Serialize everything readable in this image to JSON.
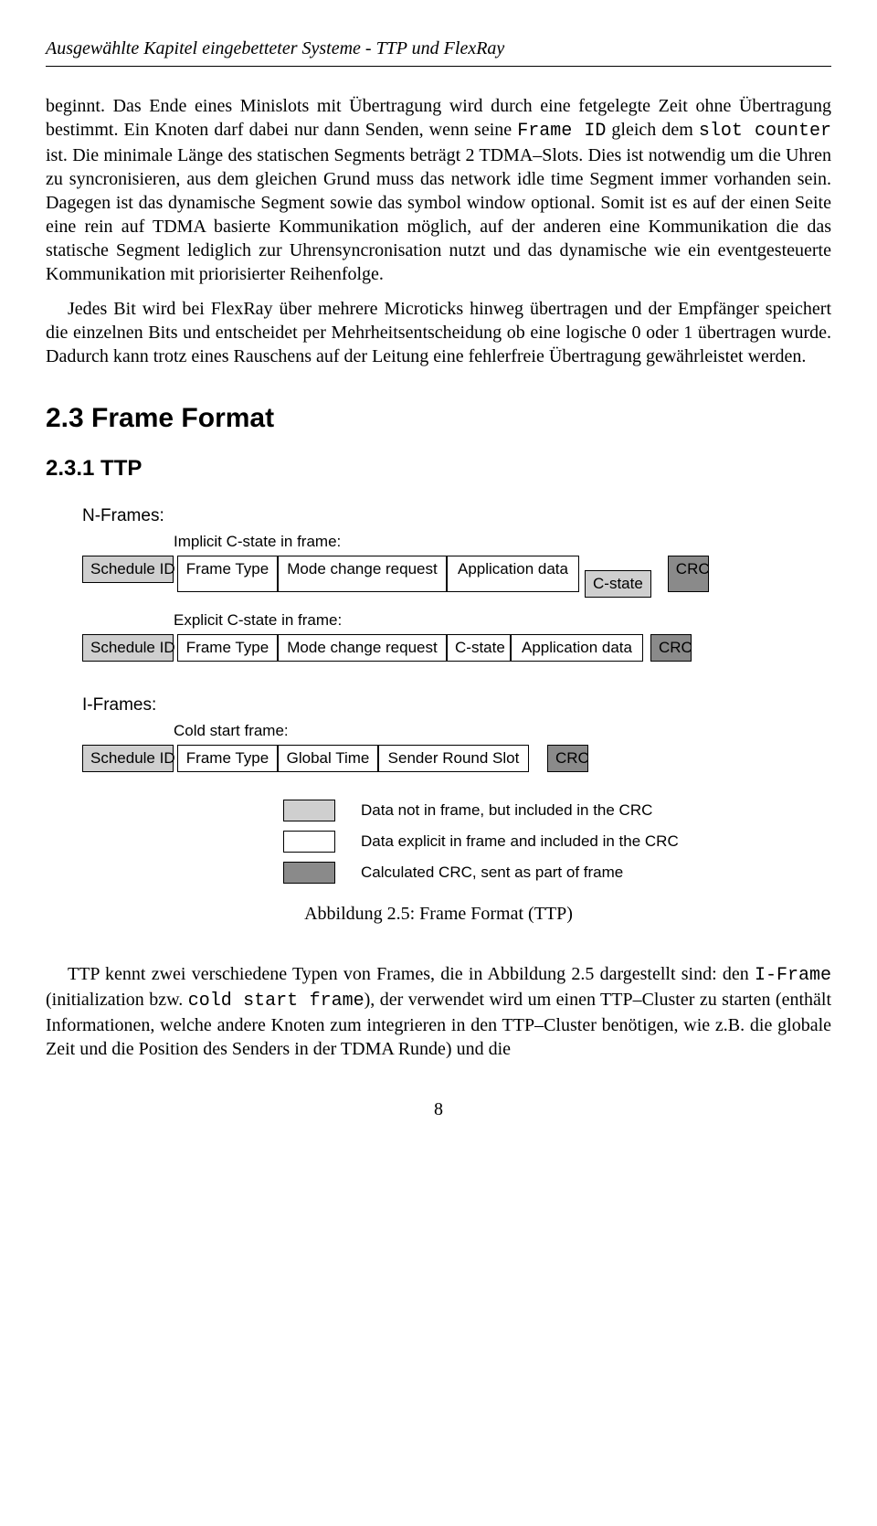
{
  "header": "Ausgewählte Kapitel eingebetteter Systeme - TTP und FlexRay",
  "para1_a": "beginnt. Das Ende eines Minislots mit Übertragung wird durch eine fetgelegte Zeit ohne Übertragung bestimmt. Ein Knoten darf dabei nur dann Senden, wenn seine ",
  "para1_mono1": "Frame ID",
  "para1_b": " gleich dem ",
  "para1_mono2": "slot counter",
  "para1_c": " ist. Die minimale Länge des statischen Segments beträgt 2 TDMA–Slots. Dies ist notwendig um die Uhren zu syncronisieren, aus dem gleichen Grund muss das network idle time Segment immer vorhanden sein. Dagegen ist das dynamische Segment sowie das symbol window optional. Somit ist es auf der einen Seite eine rein auf TDMA basierte Kommunikation möglich, auf der anderen eine Kommunikation die das statische Segment lediglich zur Uhrensyncronisation nutzt und das dynamische wie ein eventgesteuerte Kommunikation mit priorisierter Reihenfolge.",
  "para2": "Jedes Bit wird bei FlexRay über mehrere Microticks hinweg übertragen und der Empfänger speichert die einzelnen Bits und entscheidet per Mehrheitsentscheidung ob eine logische 0 oder 1 übertragen wurde. Dadurch kann trotz eines Rauschens auf der Leitung eine fehlerfreie Übertragung gewährleistet werden.",
  "section_2_3": "2.3 Frame Format",
  "subsection_2_3_1": "2.3.1 TTP",
  "diagram": {
    "nframes": "N-Frames:",
    "implicit_title": "Implicit C-state in frame:",
    "explicit_title": "Explicit C-state in frame:",
    "iframes": "I-Frames:",
    "cold_start": "Cold start frame:",
    "schedule_id": "Schedule ID",
    "frame_type": "Frame Type",
    "mode_change": "Mode change request",
    "app_data": "Application data",
    "c_state": "C-state",
    "crc": "CRC",
    "global_time": "Global Time",
    "sender_round_slot": "Sender Round Slot",
    "legend1": "Data not in frame, but included in the CRC",
    "legend2": "Data explicit in frame and included in the CRC",
    "legend3": "Calculated CRC, sent as part of frame"
  },
  "caption": "Abbildung 2.5: Frame Format (TTP)",
  "para3_a": "TTP kennt zwei verschiedene Typen von Frames, die in Abbildung 2.5 dargestellt sind: den ",
  "para3_mono1": "I-Frame",
  "para3_b": " (initialization bzw. ",
  "para3_mono2": "cold start frame",
  "para3_c": "), der verwendet wird um einen TTP–Cluster zu starten (enthält Informationen, welche andere Knoten zum integrieren in den TTP–Cluster benötigen, wie z.B. die globale Zeit und die Position des Senders in der TDMA Runde) und die",
  "page_number": "8"
}
